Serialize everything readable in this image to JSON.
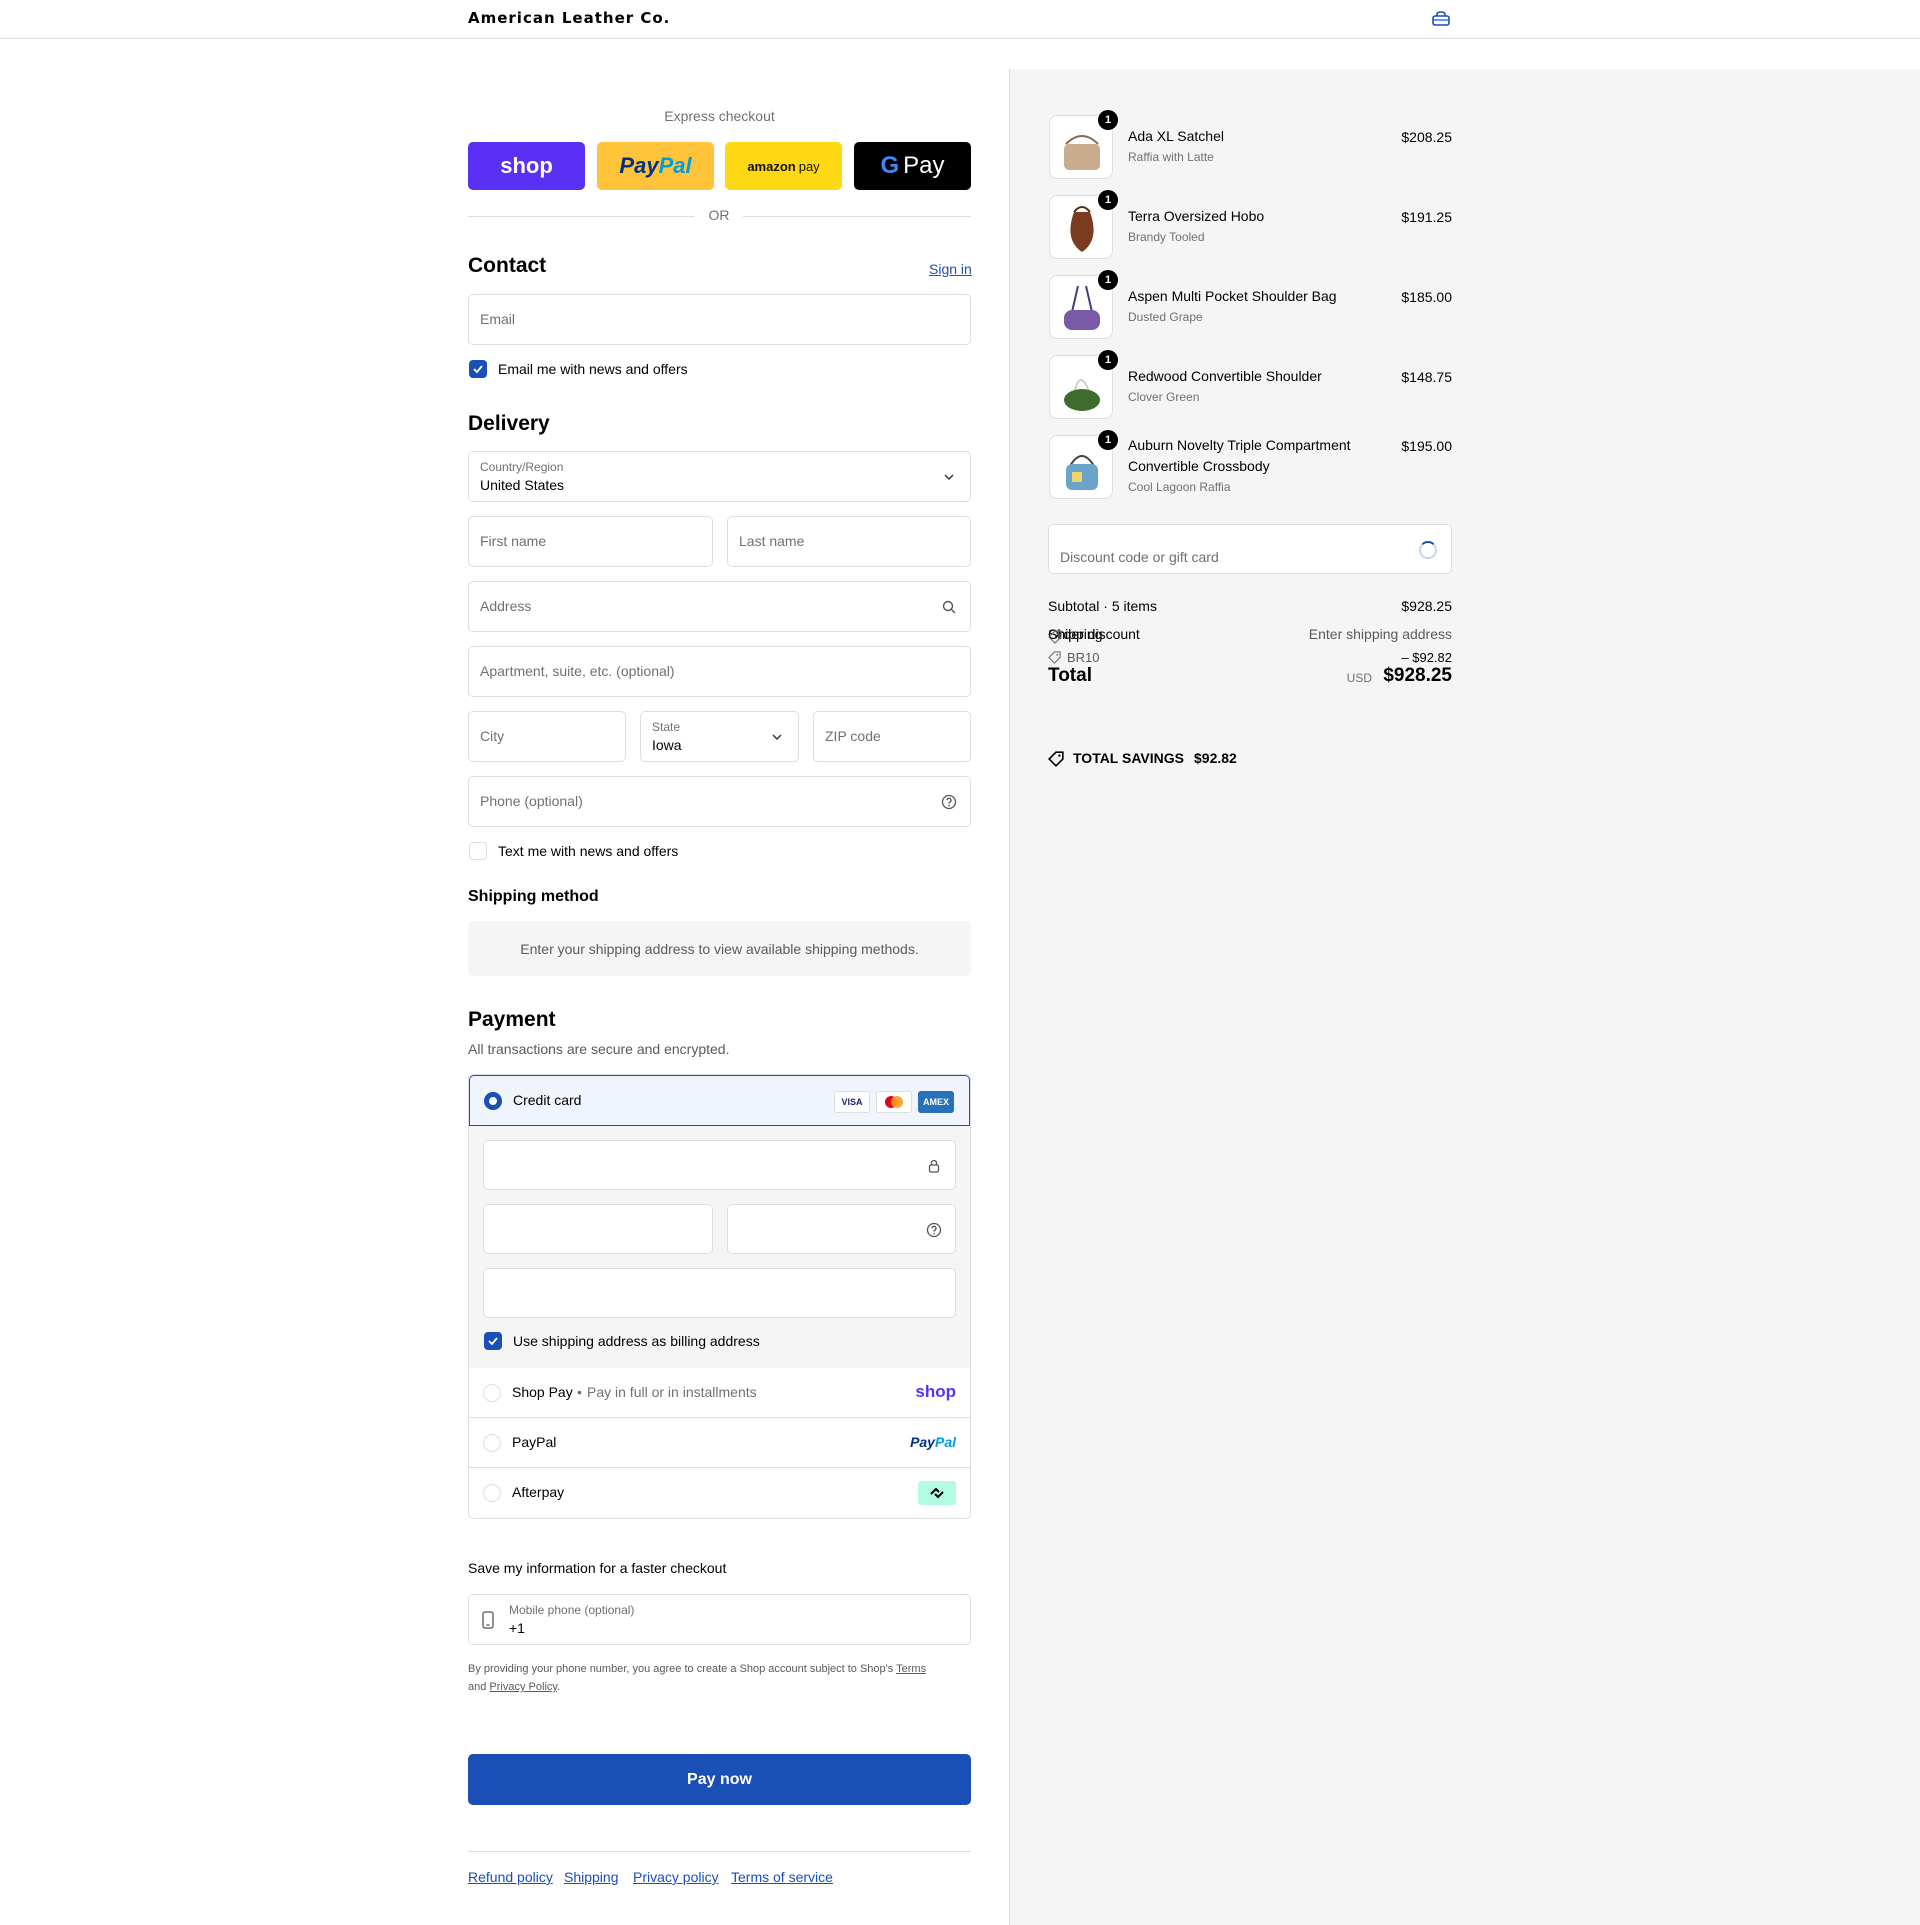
{
  "header": {
    "brand": "American Leather Co.",
    "bag_icon": "shopping-bag-icon"
  },
  "express": {
    "label": "Express checkout",
    "shop": "shop",
    "paypal_a": "Pay",
    "paypal_b": "Pal",
    "amazon_a": "amazon",
    "amazon_b": "pay",
    "gpay_g": "G",
    "gpay_label": "Pay",
    "or": "OR"
  },
  "contact": {
    "title": "Contact",
    "sign_in": "Sign in",
    "email_placeholder": "Email",
    "news_label": "Email me with news and offers"
  },
  "delivery": {
    "title": "Delivery",
    "country_label": "Country/Region",
    "country_value": "United States",
    "first_name": "First name",
    "last_name": "Last name",
    "address": "Address",
    "apartment": "Apartment, suite, etc. (optional)",
    "city": "City",
    "state_label": "State",
    "state_value": "Iowa",
    "zip": "ZIP code",
    "phone": "Phone (optional)",
    "text_label": "Text me with news and offers"
  },
  "shipping": {
    "title": "Shipping method",
    "message": "Enter your shipping address to view available shipping methods."
  },
  "payment": {
    "title": "Payment",
    "subtitle": "All transactions are secure and encrypted.",
    "credit_card": "Credit card",
    "badges": [
      "VISA",
      "",
      "AMEX"
    ],
    "billing_label": "Use shipping address as billing address",
    "shop_pay": "Shop Pay",
    "shop_pay_sub": "Pay in full or in installments",
    "shop_logo": "shop",
    "paypal": "PayPal",
    "paypal_logo_a": "Pay",
    "paypal_logo_b": "Pal",
    "afterpay": "Afterpay"
  },
  "save_info": {
    "title": "Save my information for a faster checkout",
    "mobile_label": "Mobile phone (optional)",
    "mobile_value": "+1",
    "legal_a": "By providing your phone number, you agree to create a Shop account subject to Shop's",
    "terms": "Terms",
    "legal_b": "and",
    "privacy": "Privacy Policy",
    "legal_c": "."
  },
  "pay_now": "Pay now",
  "footer": [
    "Refund policy",
    "Shipping",
    "Privacy policy",
    "Terms of service"
  ],
  "summary": {
    "items": [
      {
        "name": "Ada XL Satchel",
        "variant": "Raffia with Latte",
        "price": "$208.25",
        "qty": "1",
        "color": "#c9ab8e"
      },
      {
        "name": "Terra Oversized Hobo",
        "variant": "Brandy Tooled",
        "price": "$191.25",
        "qty": "1",
        "color": "#7a3b1e"
      },
      {
        "name": "Aspen Multi Pocket Shoulder Bag",
        "variant": "Dusted Grape",
        "price": "$185.00",
        "qty": "1",
        "color": "#7a5aa8"
      },
      {
        "name": "Redwood Convertible Shoulder",
        "variant": "Clover Green",
        "price": "$148.75",
        "qty": "1",
        "color": "#3f6b2e"
      },
      {
        "name": "Auburn Novelty Triple Compartment Convertible Crossbody",
        "variant": "Cool Lagoon Raffia",
        "price": "$195.00",
        "qty": "1",
        "color": "#6aa5c9"
      }
    ],
    "discount_placeholder": "Discount code or gift card",
    "subtotal_label": "Subtotal · 5 items",
    "subtotal_value": "$928.25",
    "shipping_label": "Shipping",
    "shipping_value": "Enter shipping address",
    "order_discount_label": "Order discount",
    "discount_code": "BR10",
    "discount_value": "– $92.82",
    "total_label": "Total",
    "currency": "USD",
    "total_value": "$928.25",
    "savings_label": "TOTAL SAVINGS",
    "savings_value": "$92.82"
  }
}
